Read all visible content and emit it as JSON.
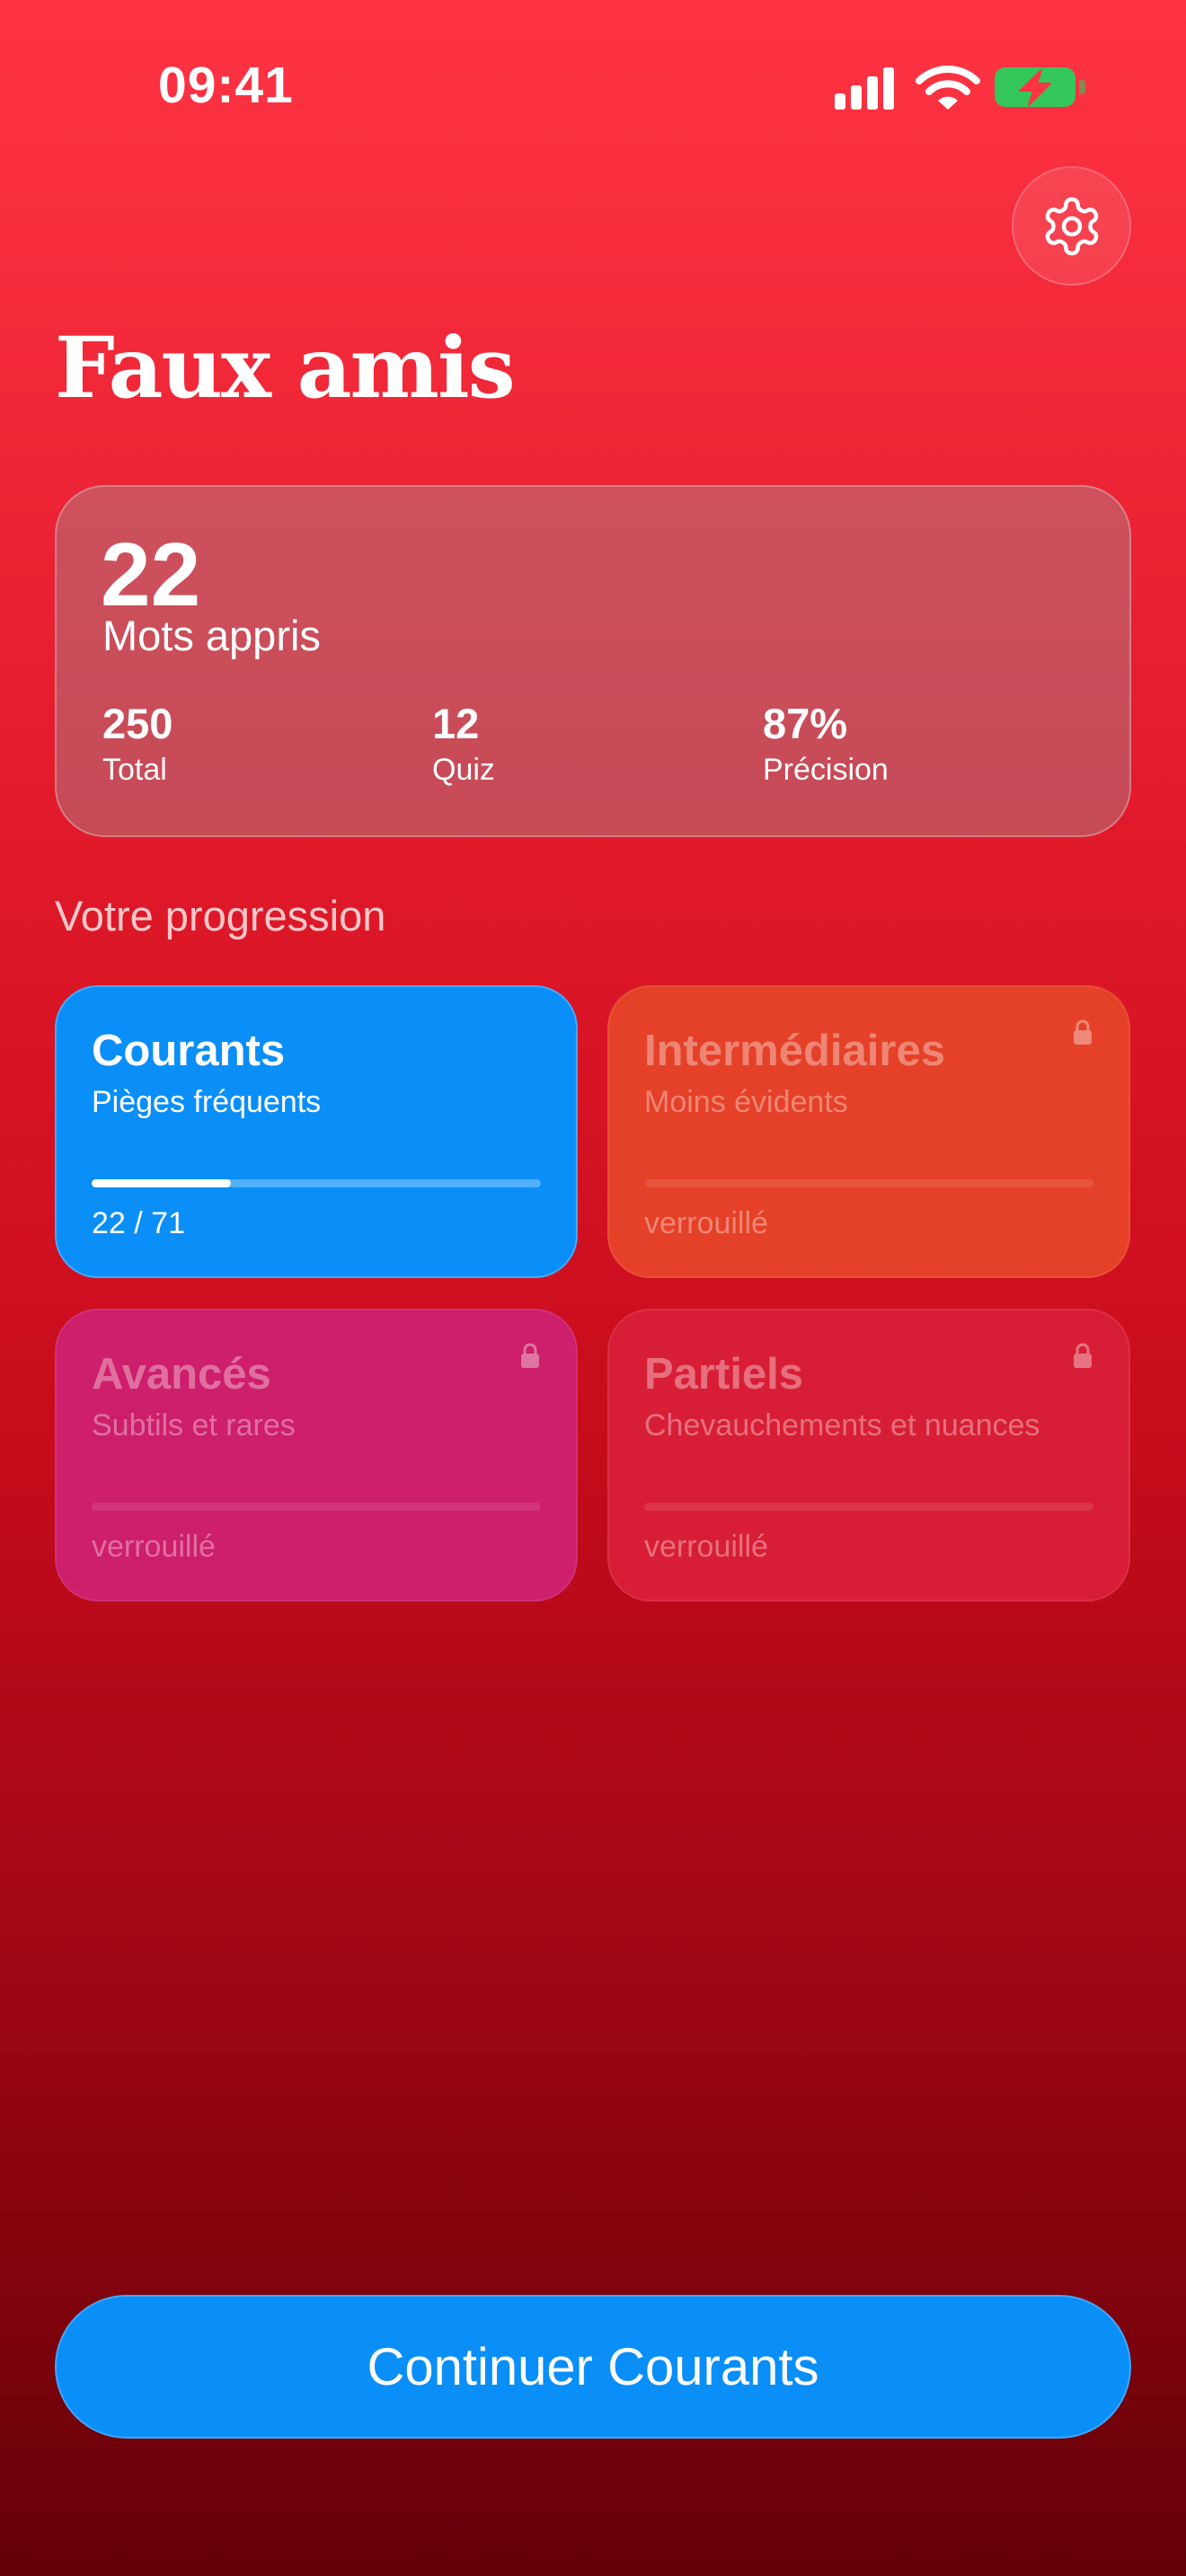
{
  "status_bar": {
    "time": "09:41",
    "icons": [
      "signal-icon",
      "wifi-icon",
      "battery-charging-icon"
    ],
    "battery_color": "#34c759"
  },
  "header": {
    "title": "Faux amis",
    "settings_icon": "gear-icon"
  },
  "stats": {
    "learned_value": "22",
    "learned_label": "Mots appris",
    "items": [
      {
        "value": "250",
        "label": "Total"
      },
      {
        "value": "12",
        "label": "Quiz"
      },
      {
        "value": "87%",
        "label": "Précision"
      }
    ]
  },
  "progress": {
    "section_label": "Votre progression",
    "levels": [
      {
        "title": "Courants",
        "subtitle": "Pièges fréquents",
        "footer": "22 / 71",
        "progress": 0.31,
        "locked": false,
        "color": "#0a8ef8"
      },
      {
        "title": "Intermédiaires",
        "subtitle": "Moins évidents",
        "footer": "verrouillé",
        "locked": true,
        "color": "#e54128"
      },
      {
        "title": "Avancés",
        "subtitle": "Subtils et rares",
        "footer": "verrouillé",
        "locked": true,
        "color": "#cd1f6b"
      },
      {
        "title": "Partiels",
        "subtitle": "Chevauchements et nuances",
        "footer": "verrouillé",
        "locked": true,
        "color": "#d81e36"
      }
    ]
  },
  "cta": {
    "label": "Continuer Courants",
    "color": "#0a8ef8"
  }
}
